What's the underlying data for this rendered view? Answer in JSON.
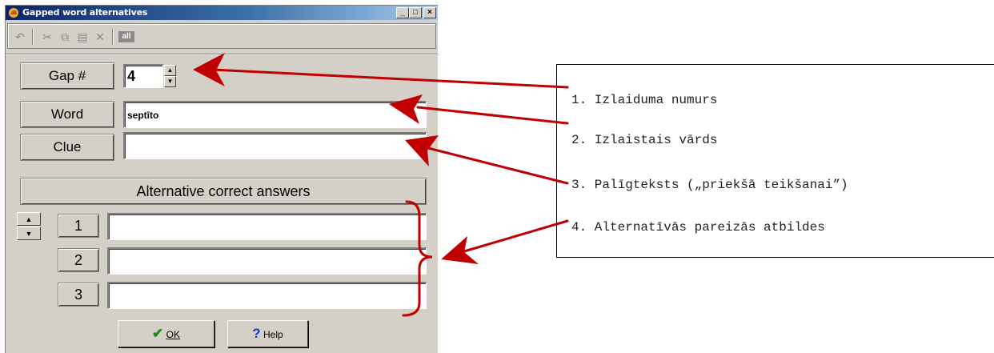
{
  "window": {
    "title": "Gapped word alternatives",
    "caption_buttons": [
      "_",
      "□",
      "×"
    ]
  },
  "toolbar": {
    "icons": [
      "undo-icon",
      "cut-icon",
      "copy-icon",
      "paste-icon",
      "delete-icon",
      "select-all-icon"
    ],
    "select_all_label": "all"
  },
  "gap": {
    "label": "Gap #",
    "value": "4"
  },
  "word": {
    "label": "Word",
    "value": "septīto"
  },
  "clue": {
    "label": "Clue",
    "value": ""
  },
  "alternatives": {
    "header": "Alternative correct answers",
    "rows": [
      {
        "number": "1",
        "value": ""
      },
      {
        "number": "2",
        "value": ""
      },
      {
        "number": "3",
        "value": ""
      }
    ]
  },
  "buttons": {
    "ok": "OK",
    "help": "Help"
  },
  "callout": {
    "items": [
      "1. Izlaiduma numurs",
      "2. Izlaistais vārds",
      "3. Palīgteksts („priekšā teikšanai”)",
      "4. Alternatīvās pareizās atbildes"
    ]
  },
  "colors": {
    "annotation_arrow": "#c00000",
    "titlebar": "#0a246a",
    "window_face": "#d4d0c8"
  }
}
